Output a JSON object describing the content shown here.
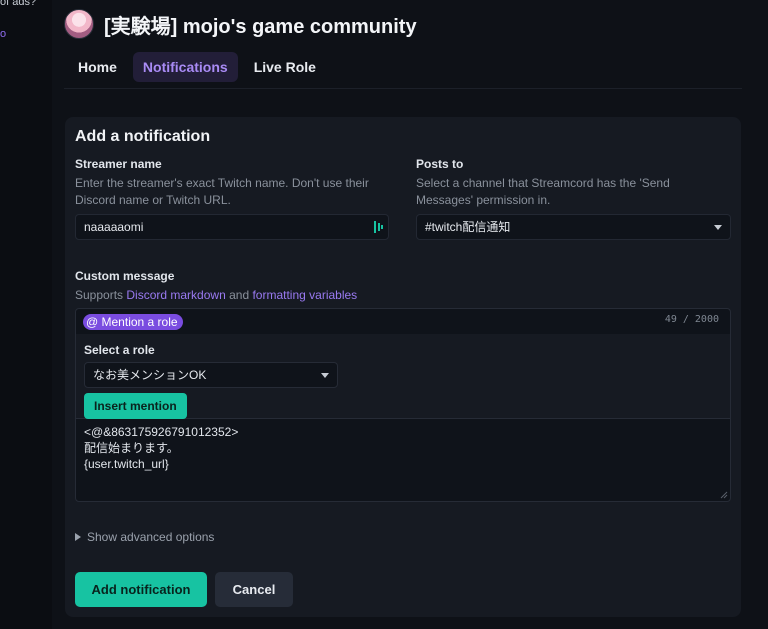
{
  "sidebar_fragment": {
    "ads_text": "of ads?",
    "link_text": "o"
  },
  "server": {
    "name": "[実験場] mojo's game community"
  },
  "tabs": [
    {
      "label": "Home",
      "active": false
    },
    {
      "label": "Notifications",
      "active": true
    },
    {
      "label": "Live Role",
      "active": false
    }
  ],
  "form": {
    "title": "Add a notification",
    "streamer": {
      "label": "Streamer name",
      "help": "Enter the streamer's exact Twitch name. Don't use their Discord name or Twitch URL.",
      "value": "naaaaaomi"
    },
    "posts_to": {
      "label": "Posts to",
      "help": "Select a channel that Streamcord has the 'Send Messages' permission in.",
      "value": "#twitch配信通知"
    },
    "custom_message": {
      "label": "Custom message",
      "help_prefix": "Supports",
      "link1": "Discord markdown",
      "help_middle": "and",
      "link2": "formatting variables",
      "mention_button": "@ Mention a role",
      "char_count": "49 / 2000",
      "role_label": "Select a role",
      "role_value": "なお美メンションOK",
      "insert_button": "Insert mention",
      "message": "<@&863175926791012352>\n配信始まります。\n{user.twitch_url}"
    },
    "advanced_label": "Show advanced options",
    "add_button": "Add notification",
    "cancel_button": "Cancel"
  },
  "colors": {
    "accent_purple": "#7a4ce0",
    "accent_teal": "#17c3a2",
    "link": "#9a7af2"
  }
}
